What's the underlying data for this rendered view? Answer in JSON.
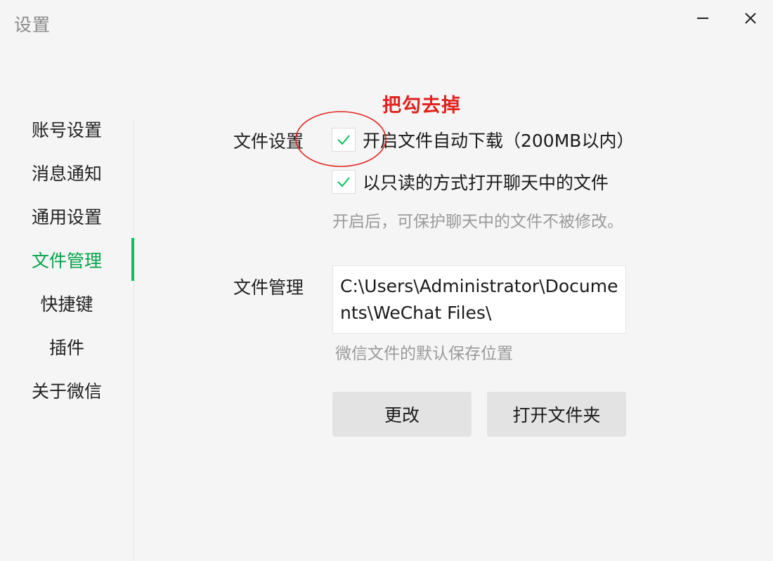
{
  "window": {
    "title": "设置",
    "minimize_icon": "minimize-icon",
    "close_icon": "close-icon"
  },
  "sidebar": {
    "items": [
      {
        "label": "账号设置",
        "active": false
      },
      {
        "label": "消息通知",
        "active": false
      },
      {
        "label": "通用设置",
        "active": false
      },
      {
        "label": "文件管理",
        "active": true
      },
      {
        "label": "快捷键",
        "active": false
      },
      {
        "label": "插件",
        "active": false
      },
      {
        "label": "关于微信",
        "active": false
      }
    ],
    "accent_color": "#07c160"
  },
  "file_settings": {
    "label": "文件设置",
    "auto_download": {
      "label": "开启文件自动下载（200MB以内）",
      "checked": true
    },
    "read_only": {
      "label": "以只读的方式打开聊天中的文件",
      "checked": true
    },
    "hint": "开启后，可保护聊天中的文件不被修改。"
  },
  "file_management": {
    "label": "文件管理",
    "path": "C:\\Users\\Administrator\\Documents\\WeChat Files\\",
    "hint": "微信文件的默认保存位置",
    "change_button": "更改",
    "open_folder_button": "打开文件夹"
  },
  "annotation": {
    "text": "把勾去掉",
    "color": "#e0231f"
  }
}
